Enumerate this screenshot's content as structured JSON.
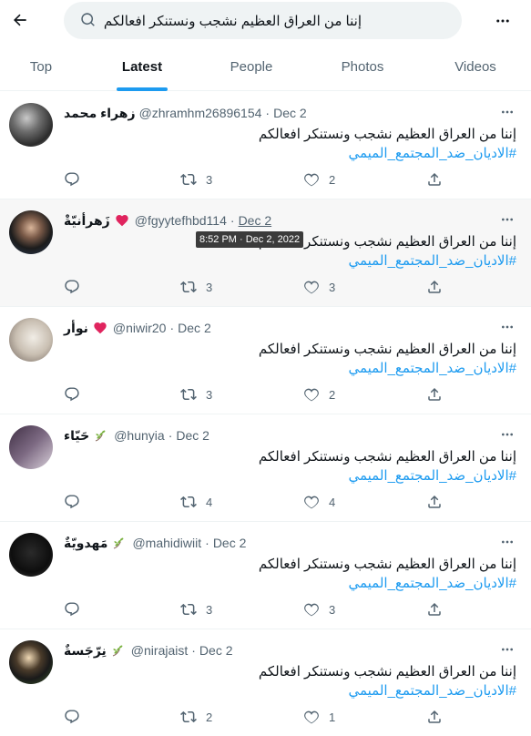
{
  "search": {
    "query": "إننا من العراق العظيم نشجب ونستنكر افعالكم"
  },
  "tabs": [
    {
      "label": "Top"
    },
    {
      "label": "Latest"
    },
    {
      "label": "Photos"
    },
    {
      "label": "People"
    },
    {
      "label": "Videos"
    }
  ],
  "tweets": [
    {
      "name": "زهراء محمد",
      "emoji": "",
      "handle": "@zhramhm26896154",
      "date": "Dec 2",
      "text": "إننا من العراق العظيم نشجب ونستنكر افعالكم",
      "hashtag": "#الاديان_ضد_المجتمع_الميمي",
      "replies": "",
      "retweets": "3",
      "likes": "2"
    },
    {
      "name": "زَهرأنيّةْ",
      "emoji": "heart",
      "handle": "@fgyytefhbd114",
      "date": "Dec 2",
      "text": "إننا من العراق العظيم نشجب ونستنكر افعالكم",
      "hashtag": "#الاديان_ضد_المجتمع_الميمي",
      "replies": "",
      "retweets": "3",
      "likes": "3"
    },
    {
      "name": "نوأر",
      "emoji": "heart",
      "handle": "@niwir20",
      "date": "Dec 2",
      "text": "إننا من العراق العظيم نشجب ونستنكر افعالكم",
      "hashtag": "#الاديان_ضد_المجتمع_الميمي",
      "replies": "",
      "retweets": "3",
      "likes": "2"
    },
    {
      "name": "حَيّاء",
      "emoji": "leaf",
      "handle": "@hunyia",
      "date": "Dec 2",
      "text": "إننا من العراق العظيم نشجب ونستنكر افعالكم",
      "hashtag": "#الاديان_ضد_المجتمع_الميمي",
      "replies": "",
      "retweets": "4",
      "likes": "4"
    },
    {
      "name": "مَهدويّةٌ",
      "emoji": "leaf",
      "handle": "@mahidiwiit",
      "date": "Dec 2",
      "text": "إننا من العراق العظيم نشجب ونستنكر افعالكم",
      "hashtag": "#الاديان_ضد_المجتمع_الميمي",
      "replies": "",
      "retweets": "3",
      "likes": "3"
    },
    {
      "name": "نِرّجَسةٌ",
      "emoji": "leaf",
      "handle": "@nirajaist",
      "date": "Dec 2",
      "text": "إننا من العراق العظيم نشجب ونستنكر افعالكم",
      "hashtag": "#الاديان_ضد_المجتمع_الميمي",
      "replies": "",
      "retweets": "2",
      "likes": "1"
    }
  ],
  "tooltip": {
    "text": "8:52 PM · Dec 2, 2022"
  },
  "colors": {
    "accent": "#1d9bf0",
    "heart": "#e0245e",
    "leaf": "#7cb342",
    "muted": "#536471"
  }
}
